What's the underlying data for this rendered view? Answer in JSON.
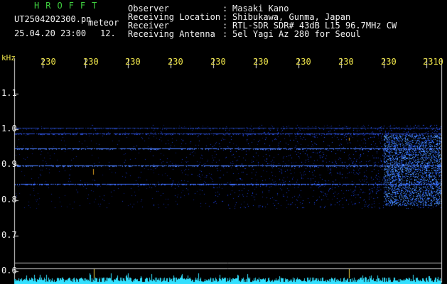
{
  "header": {
    "title": "HROFFT",
    "file_name": "UT2504202300.pn",
    "meteor_label": "meteor",
    "datetime": "25.04.20 23:00",
    "count": "12."
  },
  "metadata": {
    "labels": [
      "Observer",
      "Receiving Location",
      "Receiver",
      "Receiving Antenna"
    ],
    "separators": [
      ":",
      ":",
      ":",
      ":"
    ],
    "values": [
      "Masaki Kano",
      "Shibukawa, Gunma, Japan",
      "RTL-SDR SDR# 43dB L15 96.7MHz CW",
      "5el Yagi Az 280 for Seoul"
    ]
  },
  "axes": {
    "y_unit": "kHz",
    "y_ticks": [
      "1.1",
      "1.0",
      "0.9",
      "0.8",
      "0.7",
      "0.6"
    ],
    "x_ticks": [
      "230",
      "230",
      "230",
      "230",
      "230",
      "230",
      "230",
      "230",
      "230",
      "2310"
    ]
  },
  "colors": {
    "background": "#000000",
    "grid": "#ffffff",
    "tick_text": "#f0e64a",
    "signal": "#3a6bff",
    "noise_floor": "#33e0ff"
  }
}
